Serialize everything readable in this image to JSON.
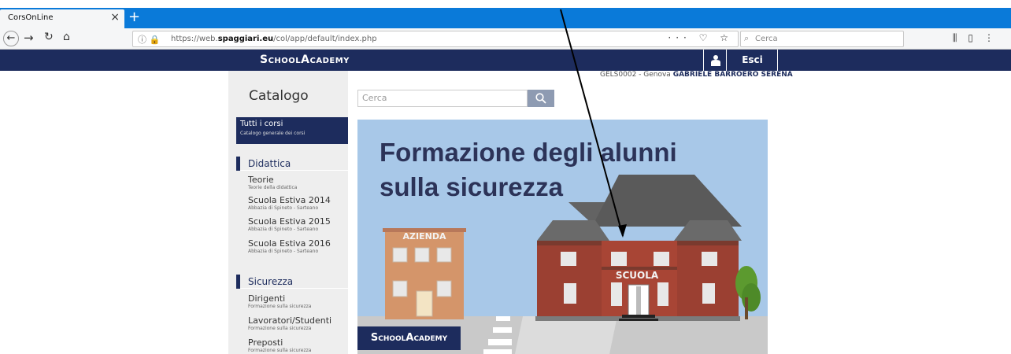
{
  "browser": {
    "tab_title": "CorsOnLine",
    "tab_close": "×",
    "new_tab": "+",
    "url_prefix": "https://web.",
    "url_domain": "spaggiari.eu",
    "url_path": "/col/app/default/index.php",
    "url_actions": "··· ♡ ☆",
    "search_placeholder": "Cerca"
  },
  "app": {
    "logo": "SchoolAcademy",
    "logout_label": "Esci",
    "user_code": "GELS0002 - Genova ",
    "user_name": "GABRIELE BARROERO SERENA"
  },
  "sidebar": {
    "title": "Catalogo",
    "all_courses": {
      "label": "Tutti i corsi",
      "sub": "Catalogo generale dei corsi"
    },
    "didattica": {
      "label": "Didattica",
      "items": [
        {
          "label": "Teorie",
          "sub": "Teorie della didattica"
        },
        {
          "label": "Scuola Estiva 2014",
          "sub": "Abbazia di Spineto - Sarteano"
        },
        {
          "label": "Scuola Estiva 2015",
          "sub": "Abbazia di Spineto - Sarteano"
        },
        {
          "label": "Scuola Estiva 2016",
          "sub": "Abbazia di Spineto - Sarteano"
        }
      ]
    },
    "sicurezza": {
      "label": "Sicurezza",
      "items": [
        {
          "label": "Dirigenti",
          "sub": "Formazione sulla sicurezza"
        },
        {
          "label": "Lavoratori/Studenti",
          "sub": "Formazione sulla sicurezza"
        },
        {
          "label": "Preposti",
          "sub": "Formazione sulla sicurezza"
        }
      ]
    }
  },
  "main": {
    "search_placeholder": "Cerca",
    "banner_title_1": "Formazione degli alunni",
    "banner_title_2": "sulla sicurezza",
    "building_left": "AZIENDA",
    "building_right": "SCUOLA",
    "banner_logo": "SchoolAcademy"
  },
  "colors": {
    "navy": "#1d2c5d",
    "tab_blue": "#0a7ad9",
    "banner_sky": "#a8c8e8"
  }
}
